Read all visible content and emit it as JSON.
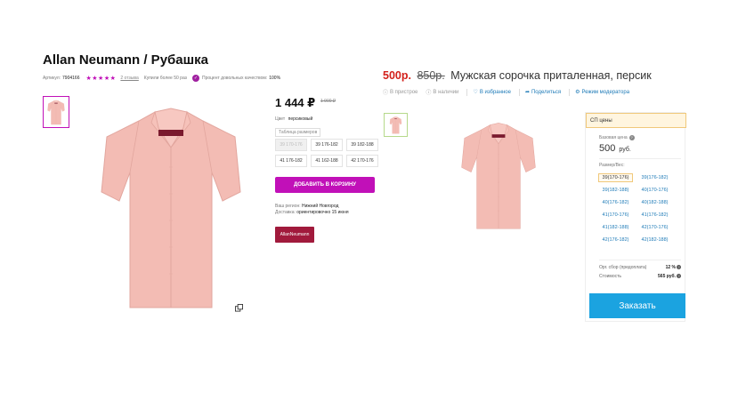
{
  "left": {
    "title": "Allan Neumann / Рубашка",
    "article_label": "Артикул:",
    "article_value": "7904166",
    "stars": "★★★★★",
    "reviews": "2 отзыва",
    "bought": "Купили более 50 раз",
    "quality_label": "Процент довольных качеством:",
    "quality_value": "100%",
    "price": "1 444 ₽",
    "old_price": "1 900 ₽",
    "color_label": "Цвет",
    "color_value": "персиковый",
    "size_table": "Таблица размеров",
    "sizes": [
      {
        "label": "39 170-176",
        "disabled": true
      },
      {
        "label": "39 176-182",
        "disabled": false
      },
      {
        "label": "39 182-188",
        "disabled": false
      },
      {
        "label": "41 176-182",
        "disabled": false
      },
      {
        "label": "41 162-188",
        "disabled": false
      },
      {
        "label": "42 170-176",
        "disabled": false
      }
    ],
    "add_to_cart": "ДОБАВИТЬ В КОРЗИНУ",
    "region_label": "Ваш регион:",
    "region_value": "Нижний Новгород",
    "delivery_label": "Доставка:",
    "delivery_value": "ориентировочно 15 июня",
    "brand_logo": "AllanNeumann"
  },
  "right": {
    "new_price": "500р.",
    "old_price": "850р.",
    "title": "Мужская сорочка приталенная, персик",
    "actions": [
      {
        "icon": "info-icon",
        "label": "В пристрое",
        "active": false
      },
      {
        "icon": "info-icon",
        "label": "В наличии",
        "active": false
      },
      {
        "icon": "heart-icon",
        "label": "В избранное",
        "active": true
      },
      {
        "icon": "share-icon",
        "label": "Поделиться",
        "active": true
      },
      {
        "icon": "gear-icon",
        "label": "Режим модератора",
        "active": true
      }
    ],
    "sp_header": "СП цены",
    "base_price_label": "Базовая цена",
    "base_price_value": "500",
    "base_price_unit": "руб.",
    "size_label": "Размер/Вес:",
    "sizes": [
      "39(170-176)",
      "39(176-182)",
      "39(182-188)",
      "40(170-176)",
      "40(176-182)",
      "40(182-188)",
      "41(170-176)",
      "41(176-182)",
      "41(182-188)",
      "42(170-176)",
      "42(176-182)",
      "42(182-188)"
    ],
    "selected_size": "39(170-176)",
    "org_fee_label": "Орг. сбор (предоплата)",
    "org_fee_value": "12 %",
    "cost_label": "Стоимость",
    "cost_value": "565 руб.",
    "order_button": "Заказать"
  },
  "colors": {
    "accent_magenta": "#c110b8",
    "price_red": "#d3201b",
    "link_blue": "#1d7ab7",
    "order_blue": "#1ba3e0",
    "shirt_peach": "#f2b8b2"
  }
}
